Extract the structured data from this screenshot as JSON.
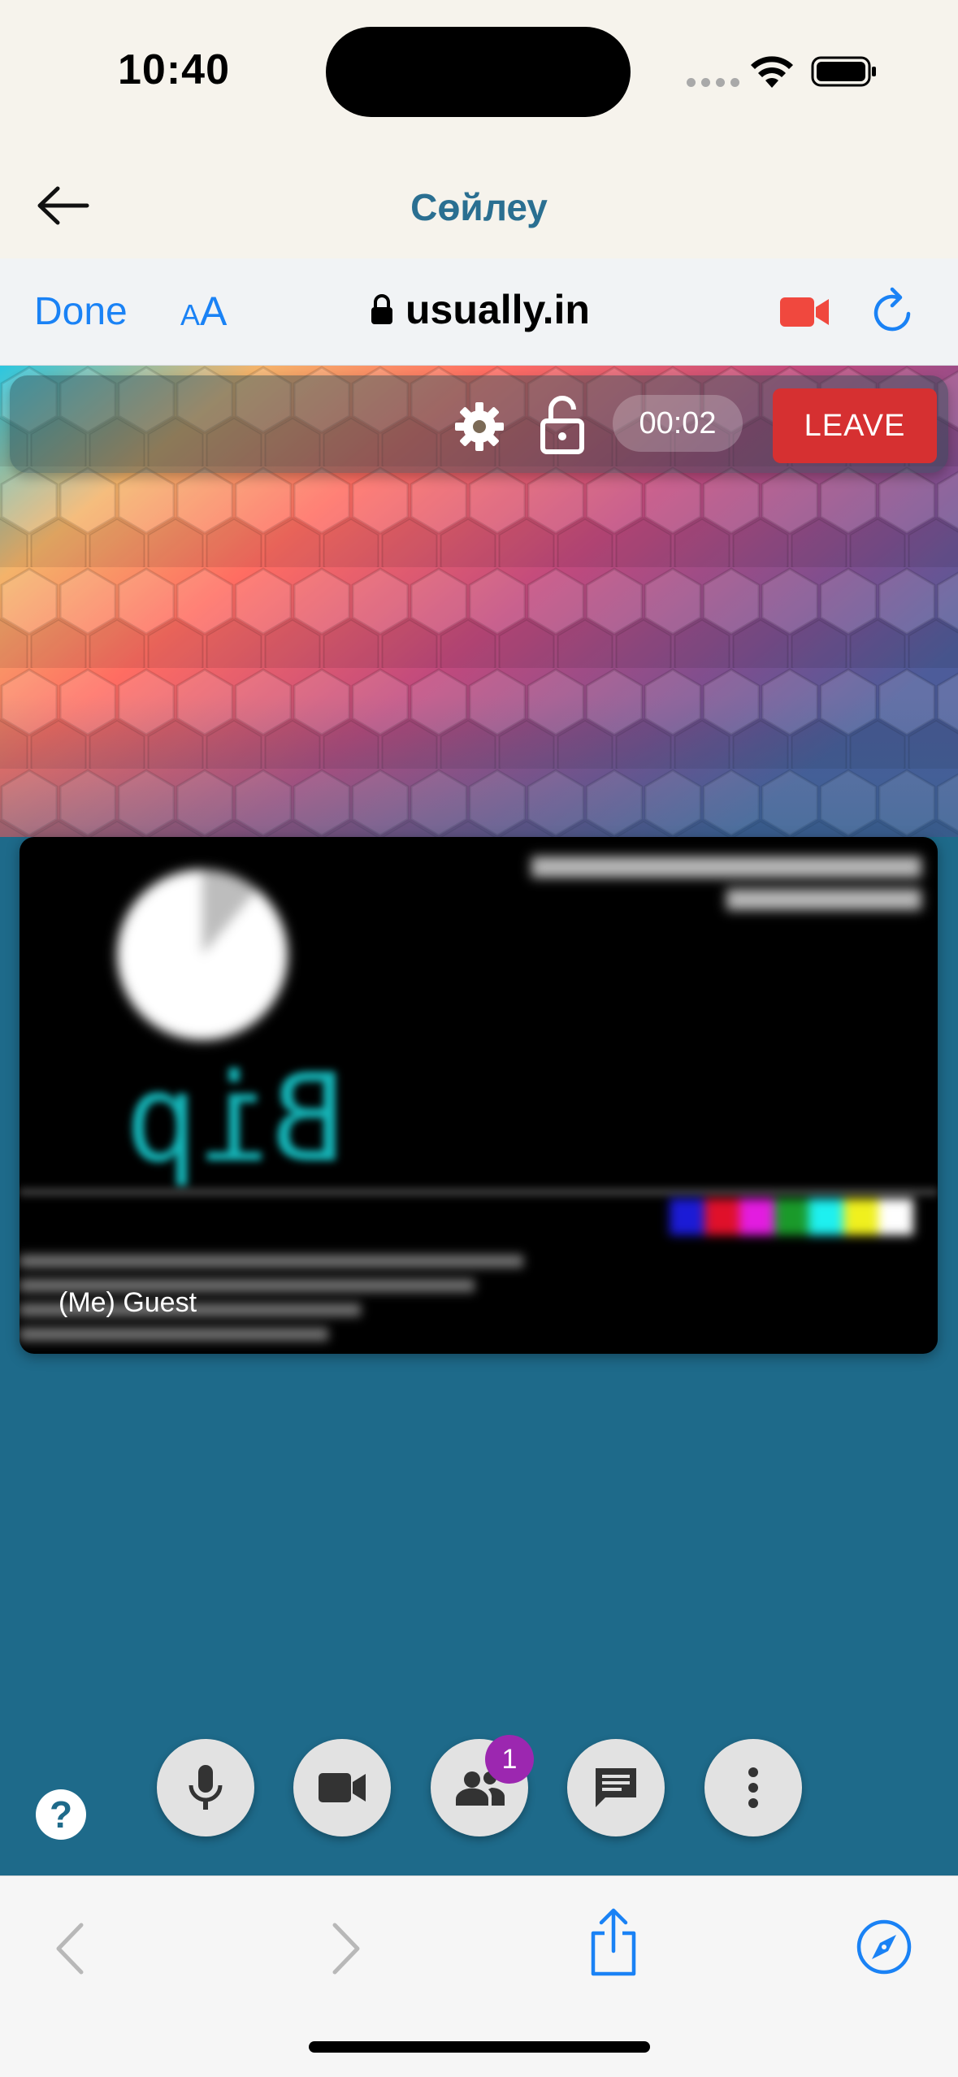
{
  "status_bar": {
    "time": "10:40"
  },
  "app_header": {
    "title": "Сөйлеу",
    "back_icon": "arrow-left-icon"
  },
  "browser_bar": {
    "done_label": "Done",
    "text_size_small": "A",
    "text_size_big": "A",
    "url": "usually.in",
    "lock_icon": "lock-icon",
    "camera_indicator_color": "#f0483e",
    "accent_color": "#1a82f5"
  },
  "call_toolbar": {
    "timer": "00:02",
    "leave_label": "LEAVE",
    "leave_color": "#d63031"
  },
  "video_tile": {
    "participant_label": "(Me) Guest",
    "test_pattern_text": "Bip"
  },
  "controls": {
    "mic_icon": "microphone-icon",
    "camera_icon": "video-camera-icon",
    "participants_icon": "people-icon",
    "participants_count": "1",
    "chat_icon": "chat-icon",
    "more_icon": "more-vertical-icon",
    "help_label": "?",
    "badge_color": "#9c27b0"
  },
  "theme": {
    "background": "#1e6a8a",
    "header_bg": "#f6f3ec"
  }
}
